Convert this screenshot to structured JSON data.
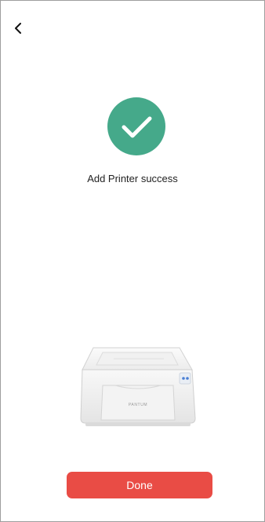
{
  "header": {
    "back_icon": "chevron-left-icon"
  },
  "status": {
    "icon": "check-circle-icon",
    "message": "Add Printer success"
  },
  "printer": {
    "image": "printer-illustration",
    "brand_text": "PANTUM"
  },
  "actions": {
    "done_label": "Done"
  },
  "colors": {
    "success_green": "#45A98A",
    "done_button_red": "#E94C45"
  }
}
